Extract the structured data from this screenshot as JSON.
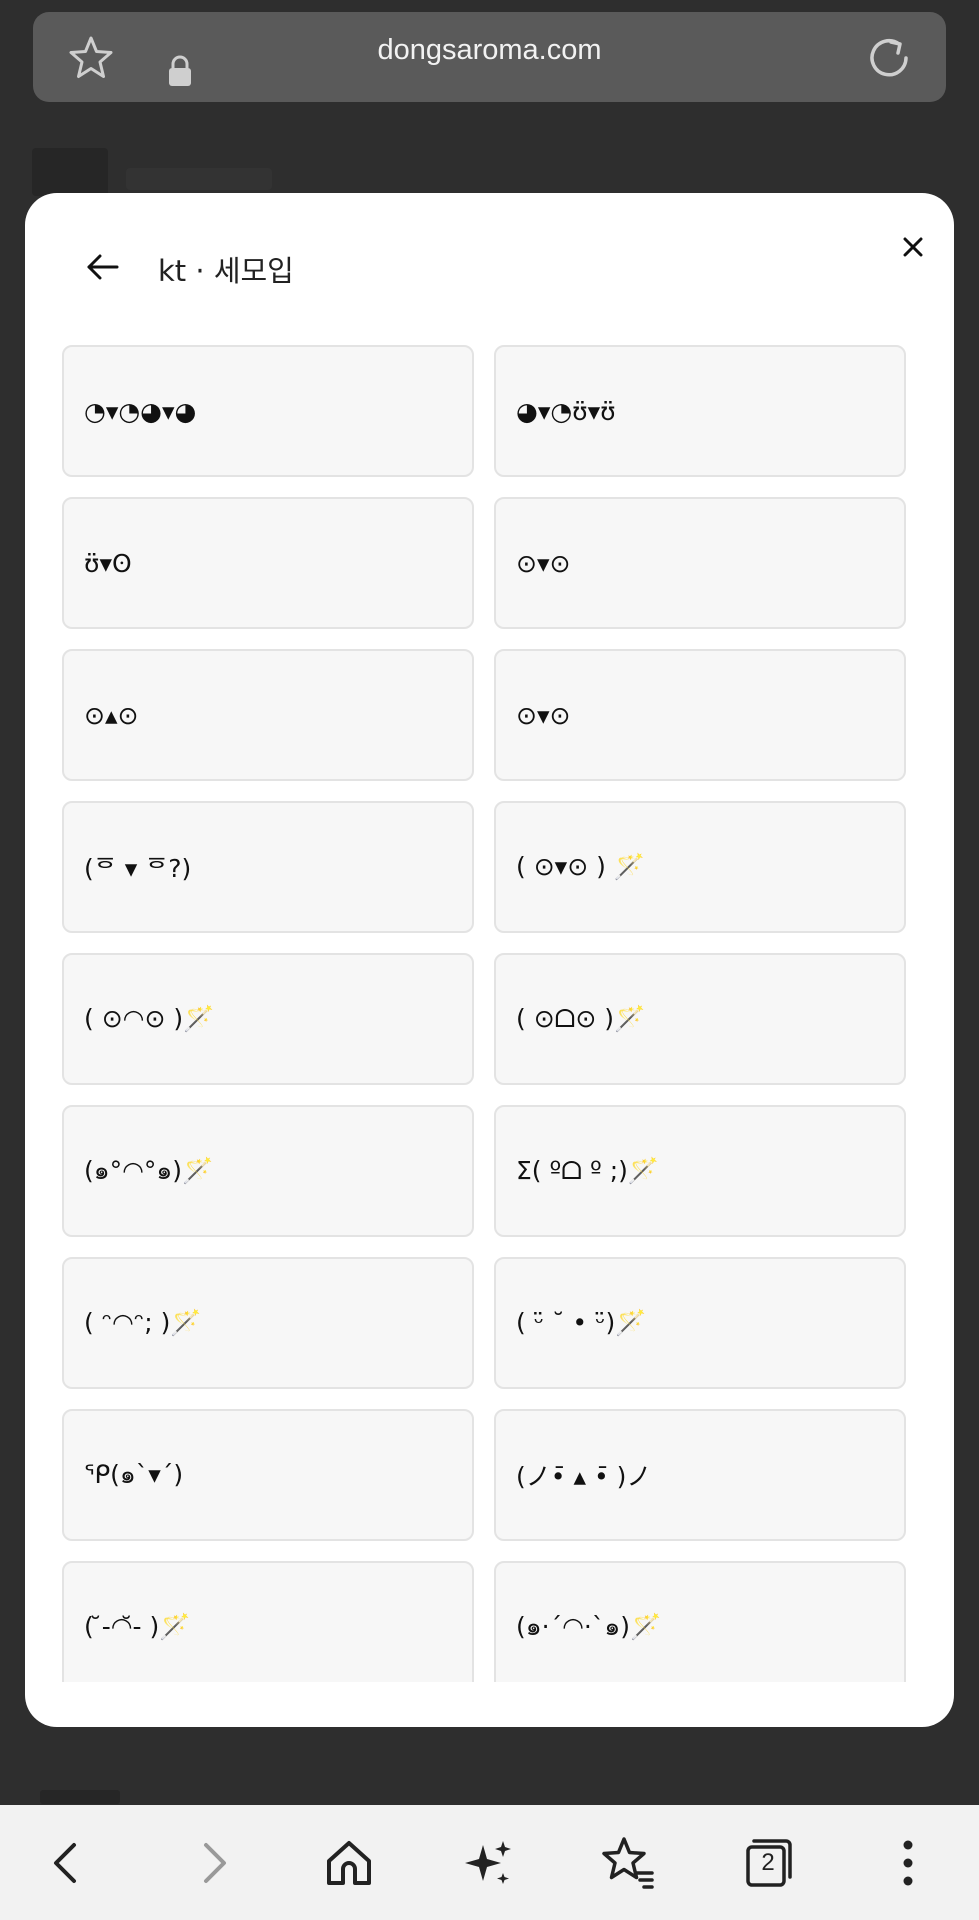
{
  "browser": {
    "url": "dongsaroma.com",
    "tab_count": "2"
  },
  "modal": {
    "title": "kt · 세모입",
    "items": [
      "◔▾◔◕▾◕",
      "◕▾◔ʊ̈▾ʊ̈",
      "ʊ̈▾ʘ",
      "⊙▾⊙",
      "⊙▴⊙",
      "⊙▾⊙",
      "(ᅙ ▾ ᅙ?)",
      "( ⊙▾⊙ ) 🪄",
      "( ⊙◠⊙ )🪄",
      "( ⊙ᗝ⊙ )🪄",
      "(๑°◠°๑)🪄",
      "Σ( ºᗝ º ;)🪄",
      "( ᵔ◠ᵔ; )🪄",
      "( ᵕ̈ ˘ • ᵕ̈)🪄",
      "ᕿ(๑`▾´)",
      "(ノ•̄ ▴ •̄ )ノ",
      "( ̆-◠̆- )🪄",
      "(๑·´◠·`๑)🪄"
    ]
  },
  "colors": {
    "modal_bg": "#ffffff",
    "card_bg": "#f7f7f7",
    "overlay_bg": "#2e2e2e"
  }
}
